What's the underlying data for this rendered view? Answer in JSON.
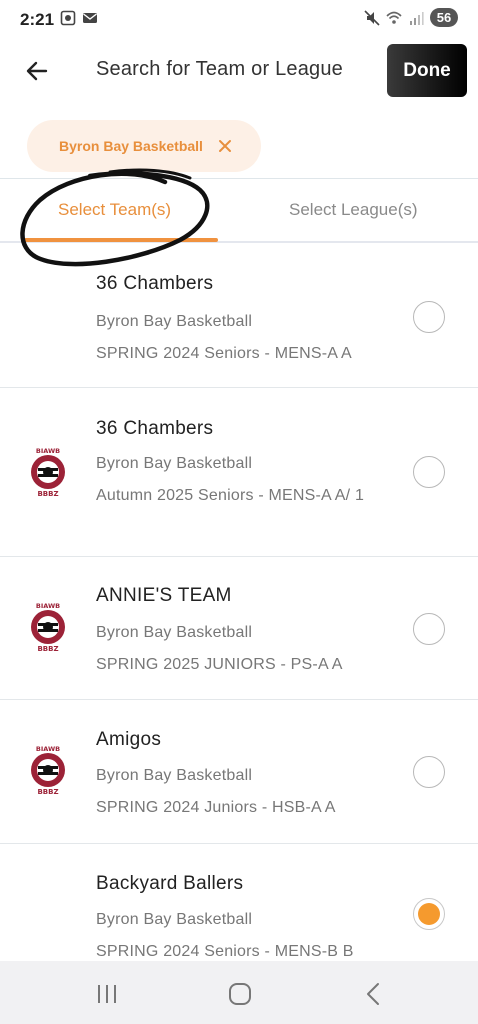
{
  "status_bar": {
    "time": "2:21",
    "battery": "56"
  },
  "header": {
    "title": "Search for Team or League",
    "done_label": "Done"
  },
  "chip": {
    "label": "Byron Bay Basketball"
  },
  "tabs": [
    {
      "label": "Select Team(s)",
      "active": true
    },
    {
      "label": "Select League(s)",
      "active": false
    }
  ],
  "teams": [
    {
      "name": "36 Chambers",
      "league": "Byron Bay Basketball",
      "division": "SPRING 2024 Seniors - MENS-A A",
      "logo": false,
      "selected": false
    },
    {
      "name": "36 Chambers",
      "league": "Byron Bay Basketball",
      "division": "Autumn 2025 Seniors - MENS-A A/ 1",
      "logo": true,
      "selected": false
    },
    {
      "name": "ANNIE'S TEAM",
      "league": "Byron Bay Basketball",
      "division": "SPRING 2025 JUNIORS - PS-A A",
      "logo": true,
      "selected": false
    },
    {
      "name": "Amigos",
      "league": "Byron Bay Basketball",
      "division": "SPRING 2024 Juniors - HSB-A A",
      "logo": true,
      "selected": false
    },
    {
      "name": "Backyard Ballers",
      "league": "Byron Bay Basketball",
      "division": "SPRING 2024 Seniors - MENS-B B",
      "logo": false,
      "selected": true
    }
  ],
  "colors": {
    "accent": "#e88f3c",
    "radio_selected": "#f59a2e",
    "chip_bg": "#fdf0e6"
  },
  "icons": {
    "back": "arrow-left-icon",
    "chip_close": "close-icon",
    "logo": "bbbz-bee-logo",
    "nav": [
      "recent-apps-icon",
      "home-icon",
      "back-nav-icon"
    ]
  }
}
